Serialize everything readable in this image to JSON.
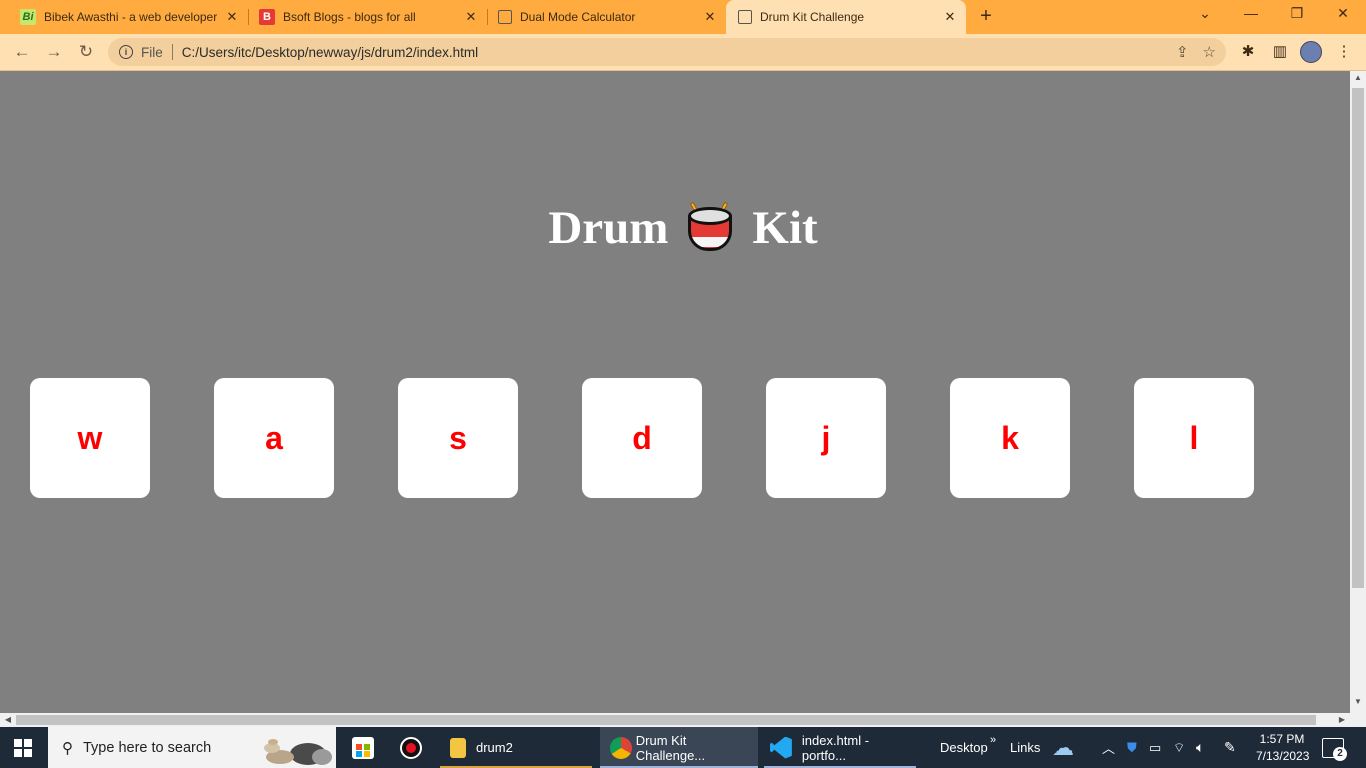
{
  "browser": {
    "tabs": [
      {
        "title": "Bibek Awasthi - a web developer",
        "favicon": "bi-icon",
        "favicon_text": "Bi",
        "active": false
      },
      {
        "title": "Bsoft Blogs - blogs for all",
        "favicon": "b-icon",
        "favicon_text": "B",
        "active": false
      },
      {
        "title": "Dual Mode Calculator",
        "favicon": "globe-icon",
        "favicon_text": "",
        "active": false
      },
      {
        "title": "Drum Kit Challenge",
        "favicon": "globe-icon",
        "favicon_text": "",
        "active": true
      }
    ],
    "new_tab_glyph": "+",
    "window_controls": {
      "dropdown": "⌄",
      "minimize": "—",
      "restore": "❐",
      "close": "✕"
    },
    "address": {
      "scheme_label": "File",
      "url": "C:/Users/itc/Desktop/newway/js/drum2/index.html"
    },
    "colors": {
      "tabstrip": "#ffab40",
      "toolbar": "#ffe0b2"
    }
  },
  "page": {
    "heading_left": "Drum",
    "heading_emoji": "drum-icon",
    "heading_right": "Kit",
    "background": "#808080",
    "drums": [
      {
        "key": "w"
      },
      {
        "key": "a"
      },
      {
        "key": "s"
      },
      {
        "key": "d"
      },
      {
        "key": "j"
      },
      {
        "key": "k"
      },
      {
        "key": "l"
      }
    ],
    "drum_text_color": "#ff0000"
  },
  "taskbar": {
    "search_placeholder": "Type here to search",
    "items": [
      {
        "label": "",
        "icon": "microsoft-store-icon"
      },
      {
        "label": "",
        "icon": "recorder-icon"
      },
      {
        "label": "drum2",
        "icon": "folder-icon"
      },
      {
        "label": "Drum Kit Challenge...",
        "icon": "chrome-icon"
      },
      {
        "label": "index.html - portfo...",
        "icon": "vscode-icon"
      }
    ],
    "toolbars": {
      "desktop": "Desktop",
      "links": "Links",
      "chevron": "»"
    },
    "clock": {
      "time": "1:57 PM",
      "date": "7/13/2023"
    },
    "notification_count": "2"
  }
}
